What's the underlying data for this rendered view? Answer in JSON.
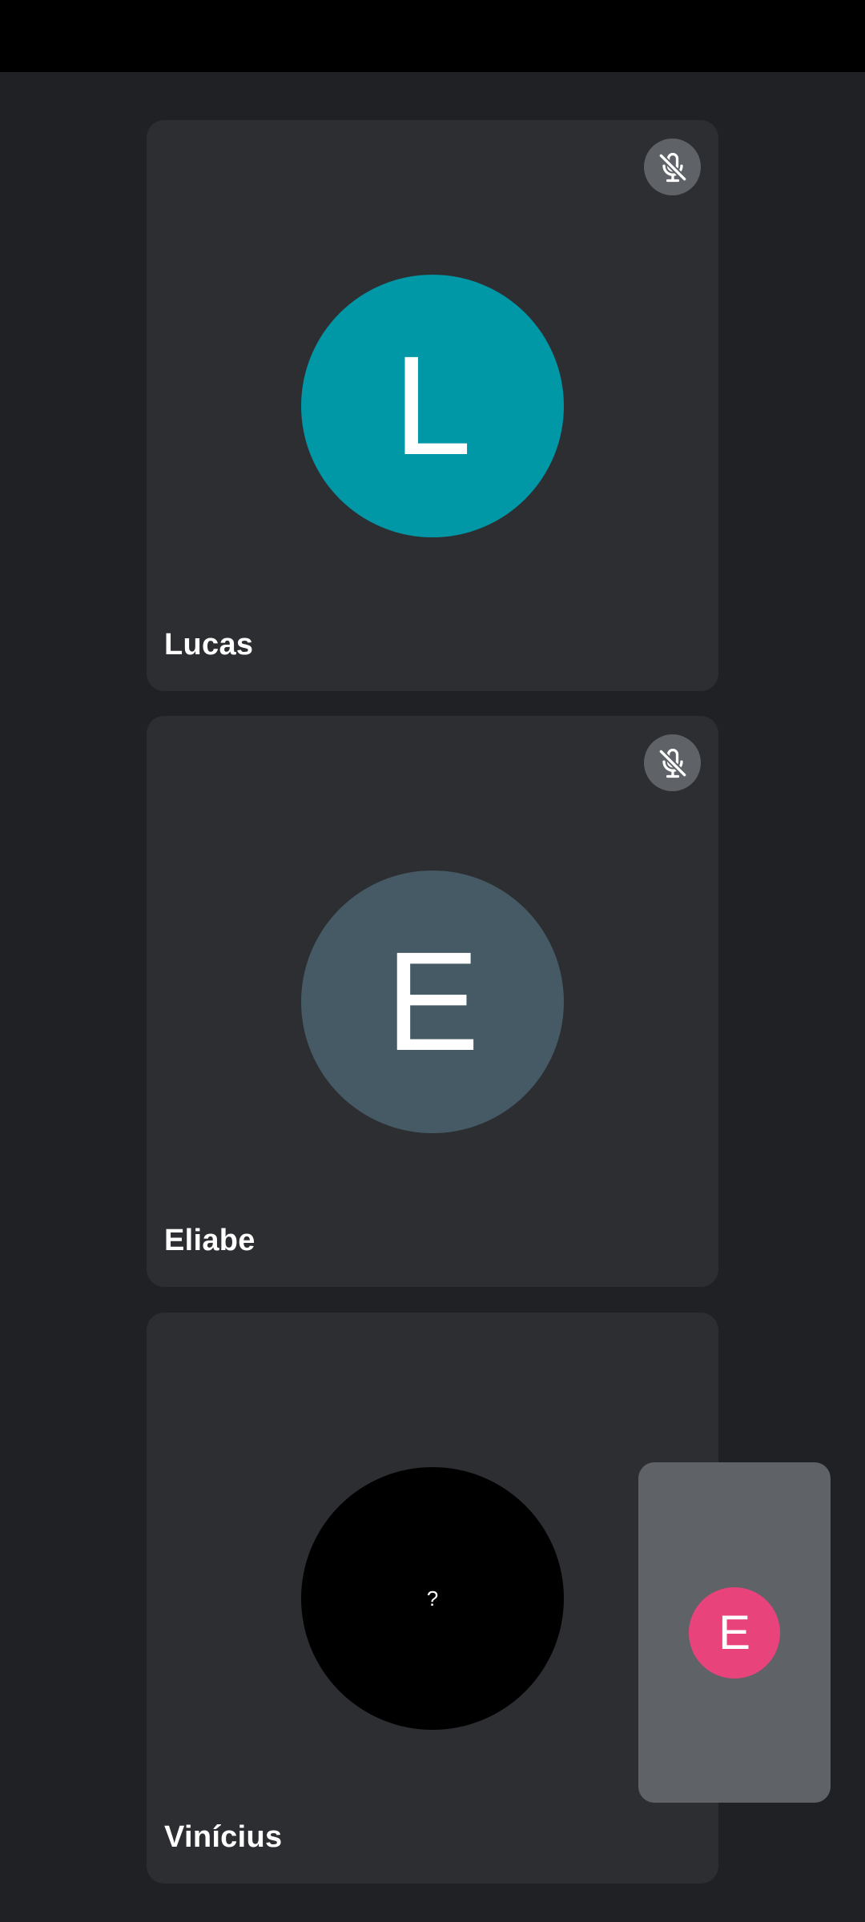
{
  "participants": [
    {
      "name": "Lucas",
      "initial": "L",
      "avatar_color": "#0097a7",
      "muted": true
    },
    {
      "name": "Eliabe",
      "initial": "E",
      "avatar_color": "#455a64",
      "muted": true
    },
    {
      "name": "Vinícius",
      "initial": "?",
      "avatar_color": "#000000",
      "muted": false
    }
  ],
  "self_view": {
    "initial": "E",
    "avatar_color": "#e8437b"
  },
  "icons": {
    "mute": "mic-off-icon"
  }
}
